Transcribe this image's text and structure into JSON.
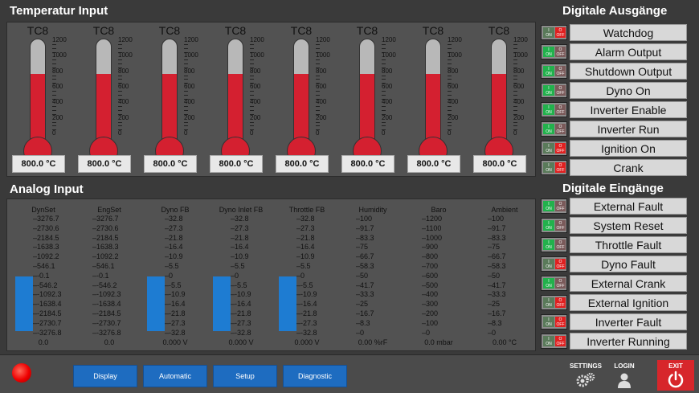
{
  "temperature": {
    "title": "Temperatur Input",
    "scale_labels": [
      "1200",
      "1000",
      "800",
      "600",
      "400",
      "200",
      "0"
    ],
    "scale_max": 1200,
    "sensors": [
      {
        "name": "TC8",
        "value": 800,
        "display": "800.0 °C"
      },
      {
        "name": "TC8",
        "value": 800,
        "display": "800.0 °C"
      },
      {
        "name": "TC8",
        "value": 800,
        "display": "800.0 °C"
      },
      {
        "name": "TC8",
        "value": 800,
        "display": "800.0 °C"
      },
      {
        "name": "TC8",
        "value": 800,
        "display": "800.0 °C"
      },
      {
        "name": "TC8",
        "value": 800,
        "display": "800.0 °C"
      },
      {
        "name": "TC8",
        "value": 800,
        "display": "800.0 °C"
      },
      {
        "name": "TC8",
        "value": 800,
        "display": "800.0 °C"
      }
    ]
  },
  "digital_out": {
    "title": "Digitale Ausgänge",
    "items": [
      {
        "label": "Watchdog",
        "state": "off"
      },
      {
        "label": "Alarm Output",
        "state": "on"
      },
      {
        "label": "Shutdown Output",
        "state": "on"
      },
      {
        "label": "Dyno On",
        "state": "on"
      },
      {
        "label": "Inverter Enable",
        "state": "on"
      },
      {
        "label": "Inverter Run",
        "state": "on"
      },
      {
        "label": "Ignition On",
        "state": "off"
      },
      {
        "label": "Crank",
        "state": "off"
      }
    ]
  },
  "digital_in": {
    "title": "Digitale Eingänge",
    "items": [
      {
        "label": "External Fault",
        "state": "on"
      },
      {
        "label": "System Reset",
        "state": "on"
      },
      {
        "label": "Throttle  Fault",
        "state": "on"
      },
      {
        "label": "Dyno Fault",
        "state": "off"
      },
      {
        "label": "External Crank",
        "state": "on"
      },
      {
        "label": "External Ignition",
        "state": "off"
      },
      {
        "label": "Inverter Fault",
        "state": "off"
      },
      {
        "label": "Inverter Running",
        "state": "off"
      }
    ],
    "on_label": "ON",
    "off_label": "OFF",
    "on_char": "I",
    "off_char": "O"
  },
  "analog": {
    "title": "Analog Input",
    "columns": [
      {
        "name": "DynSet",
        "ticks": [
          "3276.7",
          "2730.6",
          "2184.5",
          "1638.3",
          "1092.2",
          "546.1",
          "-0.1",
          "-546.2",
          "-1092.3",
          "-1638.4",
          "-2184.5",
          "-2730.7",
          "-3276.8"
        ],
        "value": "0.0",
        "bar": true
      },
      {
        "name": "EngSet",
        "ticks": [
          "3276.7",
          "2730.6",
          "2184.5",
          "1638.3",
          "1092.2",
          "546.1",
          "-0.1",
          "-546.2",
          "-1092.3",
          "-1638.4",
          "-2184.5",
          "-2730.7",
          "-3276.8"
        ],
        "value": "0.0",
        "bar": false
      },
      {
        "name": "Dyno FB",
        "ticks": [
          "32.8",
          "27.3",
          "21.8",
          "16.4",
          "10.9",
          "5.5",
          "0",
          "-5.5",
          "-10.9",
          "-16.4",
          "-21.8",
          "-27.3",
          "-32.8"
        ],
        "value": "0.000 V",
        "bar": true
      },
      {
        "name": "Dyno Inlet FB",
        "ticks": [
          "32.8",
          "27.3",
          "21.8",
          "16.4",
          "10.9",
          "5.5",
          "0",
          "-5.5",
          "-10.9",
          "-16.4",
          "-21.8",
          "-27.3",
          "-32.8"
        ],
        "value": "0.000 V",
        "bar": true
      },
      {
        "name": "Throttle FB",
        "ticks": [
          "32.8",
          "27.3",
          "21.8",
          "16.4",
          "10.9",
          "5.5",
          "0",
          "-5.5",
          "-10.9",
          "-16.4",
          "-21.8",
          "-27.3",
          "-32.8"
        ],
        "value": "0.000 V",
        "bar": true
      },
      {
        "name": "Humidity",
        "ticks": [
          "100",
          "91.7",
          "83.3",
          "75",
          "66.7",
          "58.3",
          "50",
          "41.7",
          "33.3",
          "25",
          "16.7",
          "8.3",
          "0"
        ],
        "value": "0.00 %rF",
        "bar": false
      },
      {
        "name": "Baro",
        "ticks": [
          "1200",
          "1100",
          "1000",
          "900",
          "800",
          "700",
          "600",
          "500",
          "400",
          "300",
          "200",
          "100",
          "0"
        ],
        "value": "0.0 mbar",
        "bar": false
      },
      {
        "name": "Ambient",
        "ticks": [
          "100",
          "91.7",
          "83.3",
          "75",
          "66.7",
          "58.3",
          "50",
          "41.7",
          "33.3",
          "25",
          "16.7",
          "8.3",
          "0"
        ],
        "value": "0.00 °C",
        "bar": false
      }
    ]
  },
  "nav": {
    "buttons": [
      "Display",
      "Automatic",
      "Setup",
      "Diagnostic"
    ],
    "settings": "SETTINGS",
    "login": "LOGIN",
    "exit": "EXIT"
  },
  "colors": {
    "accent": "#1e6cc0",
    "mercury": "#d42030",
    "exit": "#d7262b",
    "on": "#22b14c",
    "off": "#e02020"
  }
}
